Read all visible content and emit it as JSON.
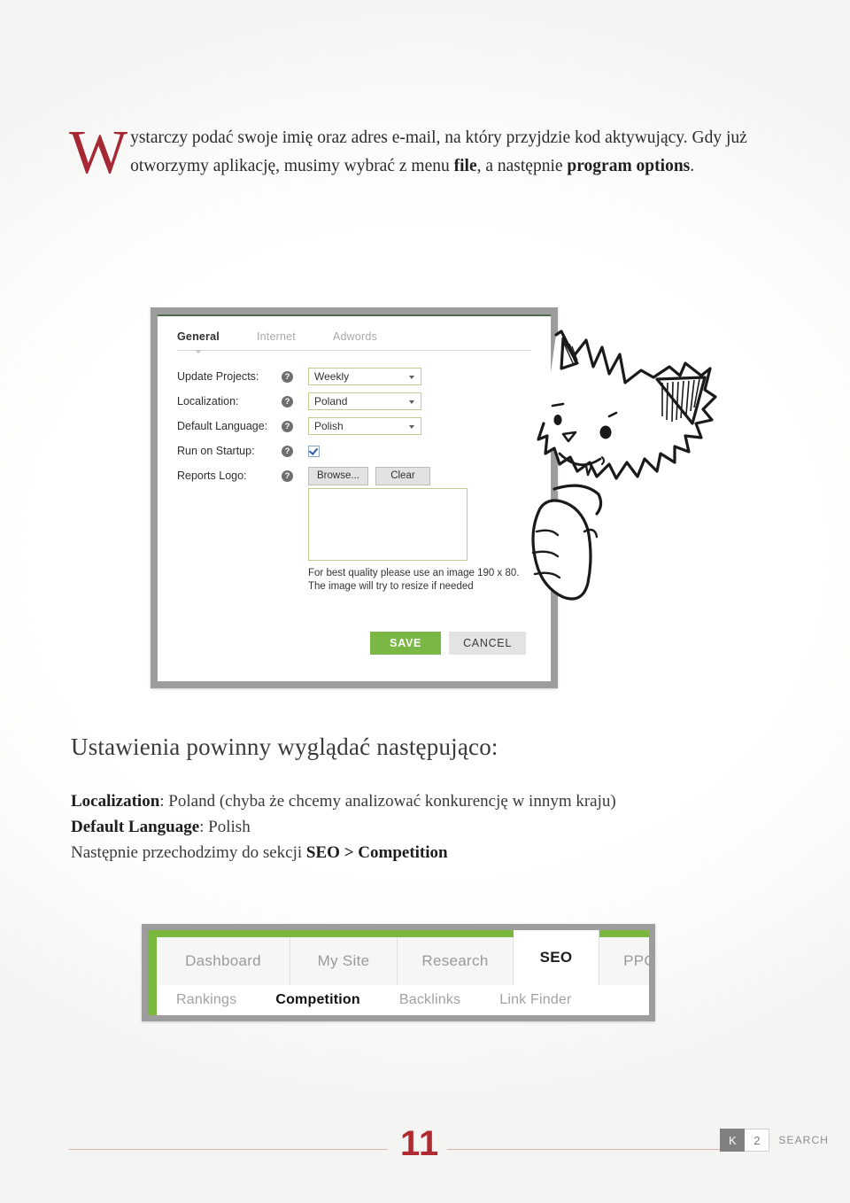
{
  "page": {
    "number": "11"
  },
  "intro": {
    "dropcap": "W",
    "line1_a": "ystarczy podać swoje imię oraz adres e-mail, na który przyjdzie kod aktywujący. ",
    "line2_a": "Gdy już otworzymy aplikację, musimy wybrać z menu ",
    "bold1": "file",
    "line2_b": ", a następnie ",
    "bold2": "program options",
    "line2_c": "."
  },
  "options_dialog": {
    "tabs": [
      {
        "label": "General",
        "active": true
      },
      {
        "label": "Internet",
        "active": false
      },
      {
        "label": "Adwords",
        "active": false
      }
    ],
    "rows": [
      {
        "label": "Update Projects:",
        "help": "?",
        "control": "select",
        "value": "Weekly"
      },
      {
        "label": "Localization:",
        "help": "?",
        "control": "select",
        "value": "Poland"
      },
      {
        "label": "Default Language:",
        "help": "?",
        "control": "select",
        "value": "Polish"
      },
      {
        "label": "Run on Startup:",
        "help": "?",
        "control": "checkbox",
        "value": "checked"
      },
      {
        "label": "Reports Logo:",
        "help": "?",
        "control": "buttons",
        "value": ""
      }
    ],
    "browse_label": "Browse...",
    "clear_label": "Clear",
    "logo_hint_line1": "For best quality please use an image 190 x 80.",
    "logo_hint_line2": "The image will try to resize if needed",
    "save_label": "SAVE",
    "cancel_label": "CANCEL",
    "accent_green": "#7ab745",
    "field_border_green": "#b9cf8e",
    "frame_gray": "#9d9d9d"
  },
  "mid_text": {
    "heading": "Ustawienia powinny wyglądać następująco:",
    "line1_bold": "Localization",
    "line1_rest": ": Poland (chyba że chcemy analizować konkurencję w innym kraju)",
    "line2_bold": "Default Language",
    "line2_rest": ": Polish",
    "line3_pre": "Następnie przechodzimy do sekcji ",
    "line3_bold": "SEO > Competition"
  },
  "nav_screenshot": {
    "tabs": [
      {
        "label": "Dashboard",
        "active": false
      },
      {
        "label": "My Site",
        "active": false
      },
      {
        "label": "Research",
        "active": false
      },
      {
        "label": "SEO",
        "active": true
      },
      {
        "label": "PPC",
        "active": false
      }
    ],
    "subtabs": [
      {
        "label": "Rankings",
        "active": false
      },
      {
        "label": "Competition",
        "active": true
      },
      {
        "label": "Backlinks",
        "active": false
      },
      {
        "label": "Link Finder",
        "active": false
      }
    ],
    "accent_green": "#7ab73f",
    "frame_gray": "#9d9d9d"
  },
  "footer": {
    "page_number": "11",
    "brand_k": "K",
    "brand_2": "2",
    "brand_word": "SEARCH",
    "rule_color": "#d9b0ab",
    "page_number_color": "#b02b31"
  }
}
